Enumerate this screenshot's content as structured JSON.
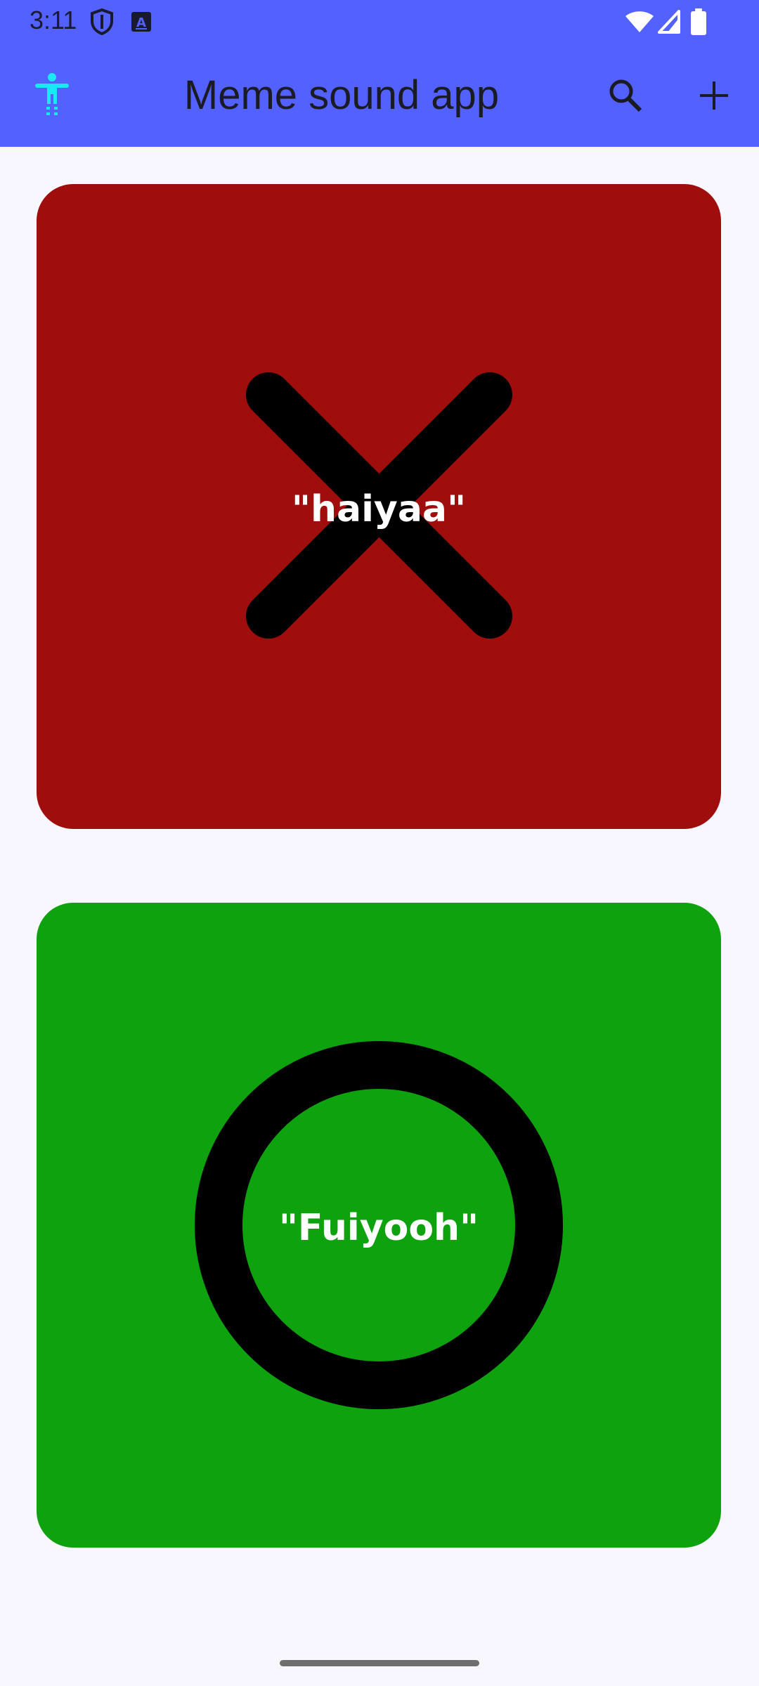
{
  "status_bar": {
    "time": "3:11",
    "left_icons": [
      "shield-icon",
      "keyboard-icon"
    ],
    "right_icons": [
      "wifi-icon",
      "cellular-signal-icon",
      "battery-icon"
    ]
  },
  "app_bar": {
    "title": "Meme sound app",
    "left_icon": "accessibility-icon",
    "actions": [
      "search-icon",
      "add-icon"
    ]
  },
  "cards": [
    {
      "label": "\"haiyaa\"",
      "color": "#a00d0d",
      "symbol": "x-mark"
    },
    {
      "label": "\"Fuiyooh\"",
      "color": "#0ea20e",
      "symbol": "circle"
    }
  ],
  "colors": {
    "app_bar": "#5261ff",
    "background": "#f8f6fe",
    "accessibility_icon": "#19e8f5"
  }
}
